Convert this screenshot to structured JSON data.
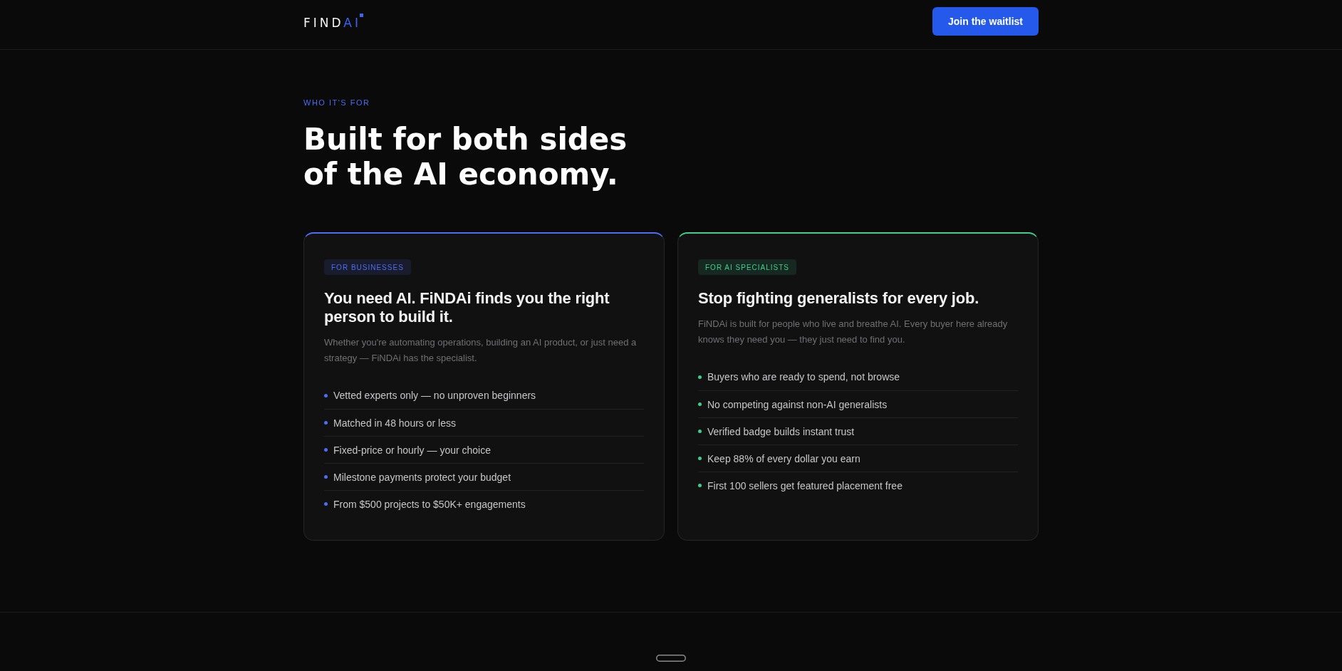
{
  "header": {
    "logo": {
      "text": "FIND",
      "accent": "AI"
    },
    "cta": "Join the waitlist"
  },
  "intro": {
    "eyebrow": "WHO IT'S FOR",
    "heading": "Built for both sides of the AI economy."
  },
  "cards": [
    {
      "badge": "FOR BUSINESSES",
      "color": "#4d6ef5",
      "title": "You need AI. FiNDAi finds you the right person to build it.",
      "description": "Whether you're automating operations, building an AI product, or just need a strategy — FiNDAi has the specialist.",
      "items": [
        "Vetted experts only — no unproven beginners",
        "Matched in 48 hours or less",
        "Fixed-price or hourly — your choice",
        "Milestone payments protect your budget",
        "From $500 projects to $50K+ engagements"
      ]
    },
    {
      "badge": "FOR AI SPECIALISTS",
      "color": "#3ecf8e",
      "title": "Stop fighting generalists for every job.",
      "description": "FiNDAi is built for people who live and breathe AI. Every buyer here already knows they need you — they just need to find you.",
      "items": [
        "Buyers who are ready to spend, not browse",
        "No competing against non-AI generalists",
        "Verified badge builds instant trust",
        "Keep 88% of every dollar you earn",
        "First 100 sellers get featured placement free"
      ]
    }
  ]
}
